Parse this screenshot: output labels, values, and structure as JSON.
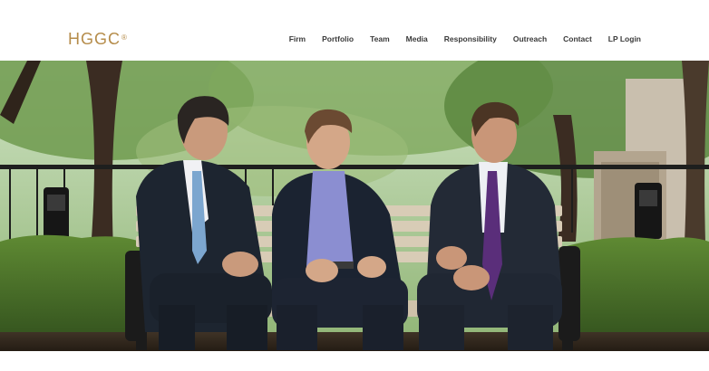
{
  "header": {
    "logo_text": "HGGC",
    "logo_mark": "®"
  },
  "nav": {
    "items": [
      {
        "label": "Firm"
      },
      {
        "label": "Portfolio"
      },
      {
        "label": "Team"
      },
      {
        "label": "Media"
      },
      {
        "label": "Responsibility"
      },
      {
        "label": "Outreach"
      },
      {
        "label": "Contact"
      },
      {
        "label": "LP Login"
      }
    ]
  },
  "hero": {
    "image_name": "hero-photo-three-men-on-bench"
  },
  "colors": {
    "logo": "#b58c4a",
    "nav_text": "#3a3a3a",
    "background": "#ffffff"
  }
}
